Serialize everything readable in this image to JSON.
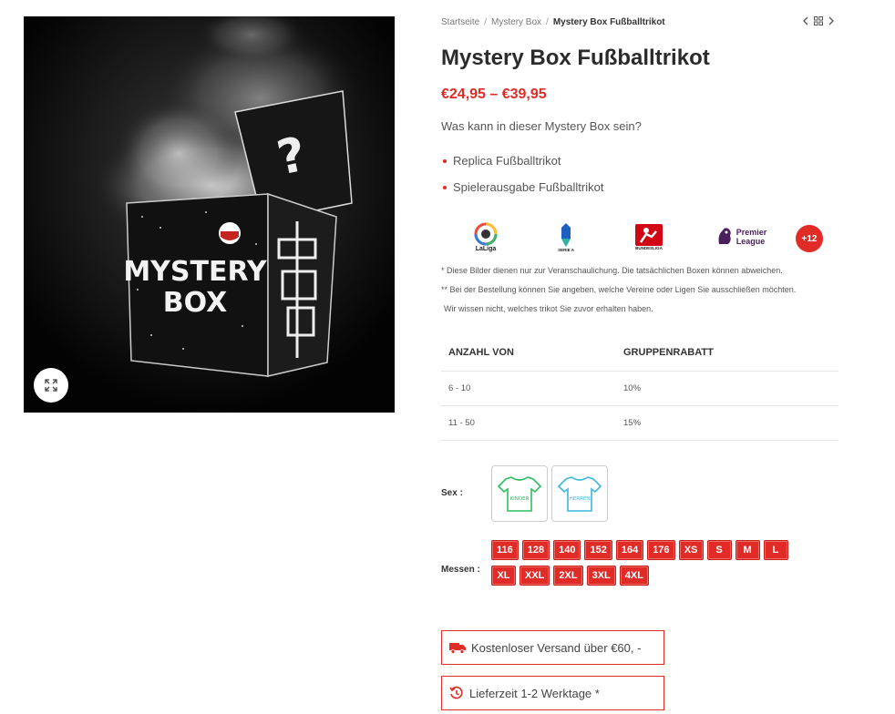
{
  "product_image": {
    "box_text_line1": "MYSTERY",
    "box_text_line2": "BOX",
    "zoom_icon": "expand-icon"
  },
  "breadcrumb": {
    "items": [
      "Startseite",
      "Mystery Box"
    ],
    "current": "Mystery Box Fußballtrikot",
    "separator": "/"
  },
  "product": {
    "title": "Mystery Box Fußballtrikot",
    "price": "€24,95 – €39,95",
    "question": "Was kann in dieser Mystery Box sein?",
    "bullets": [
      "Replica Fußballtrikot",
      "Spielerausgabe Fußballtrikot"
    ]
  },
  "leagues": {
    "items": [
      {
        "name": "LaLiga",
        "icon": "laliga-logo"
      },
      {
        "name": "SERIE A",
        "icon": "serie-a-logo"
      },
      {
        "name": "BUNDESLIGA",
        "icon": "bundesliga-logo"
      },
      {
        "name_line1": "Premier",
        "name_line2": "League",
        "icon": "premier-league-logo"
      }
    ],
    "more": "+12"
  },
  "notes": [
    "*  Diese Bilder dienen nur zur Veranschaulichung. Die tatsächlichen Boxen können abweichen.",
    "** Bei der Bestellung können Sie angeben, welche Vereine oder Ligen Sie ausschließen möchten.",
    "Wir wissen nicht, welches trikot Sie zuvor erhalten haben."
  ],
  "discount_table": {
    "headers": [
      "ANZAHL VON",
      "GRUPPENRABATT"
    ],
    "rows": [
      [
        "6 - 10",
        "10%"
      ],
      [
        "11 - 50",
        "15%"
      ]
    ]
  },
  "options": {
    "sex_label": "Sex :",
    "sex_swatches": [
      {
        "label": "KINDER",
        "color": "#2dbd5e"
      },
      {
        "label": "HERREN",
        "color": "#3cb7e0"
      }
    ],
    "size_label": "Messen :",
    "sizes": [
      "116",
      "128",
      "140",
      "152",
      "164",
      "176",
      "XS",
      "S",
      "M",
      "L",
      "XL",
      "XXL",
      "2XL",
      "3XL",
      "4XL"
    ]
  },
  "info_boxes": [
    {
      "text": "Kostenloser Versand über €60, -",
      "icon": "truck-icon"
    },
    {
      "text": "Lieferzeit 1-2 Werktage *",
      "icon": "history-icon"
    }
  ],
  "colors": {
    "accent": "#e02b27",
    "text": "#333333"
  }
}
